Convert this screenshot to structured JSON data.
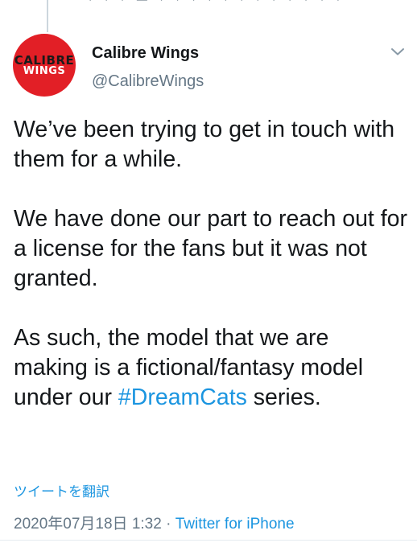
{
  "top_cut_text": "· · · — · · · · · · · · · · · ·",
  "tweet": {
    "author": {
      "display_name": "Calibre Wings",
      "handle": "@CalibreWings",
      "avatar_line1": "CALIBRE",
      "avatar_line2": "WINGS",
      "avatar_color": "#e21f26"
    },
    "body": {
      "p1": "We’ve been trying to get in touch with them for a while.",
      "p2": "We have done our part to reach out for a license for the fans but it was not granted.",
      "p3_before": "As such, the model that we are making is a fictional/fantasy model under our ",
      "p3_hashtag": "#DreamCats",
      "p3_after": " series."
    },
    "translate_label": "ツイートを翻訳",
    "timestamp": "2020年07月18日 1:32",
    "separator": " · ",
    "source": "Twitter for iPhone",
    "menu_icon": "chevron-down-icon"
  },
  "colors": {
    "link": "#1b95e0",
    "secondary_text": "#657786",
    "primary_text": "#14171a"
  }
}
